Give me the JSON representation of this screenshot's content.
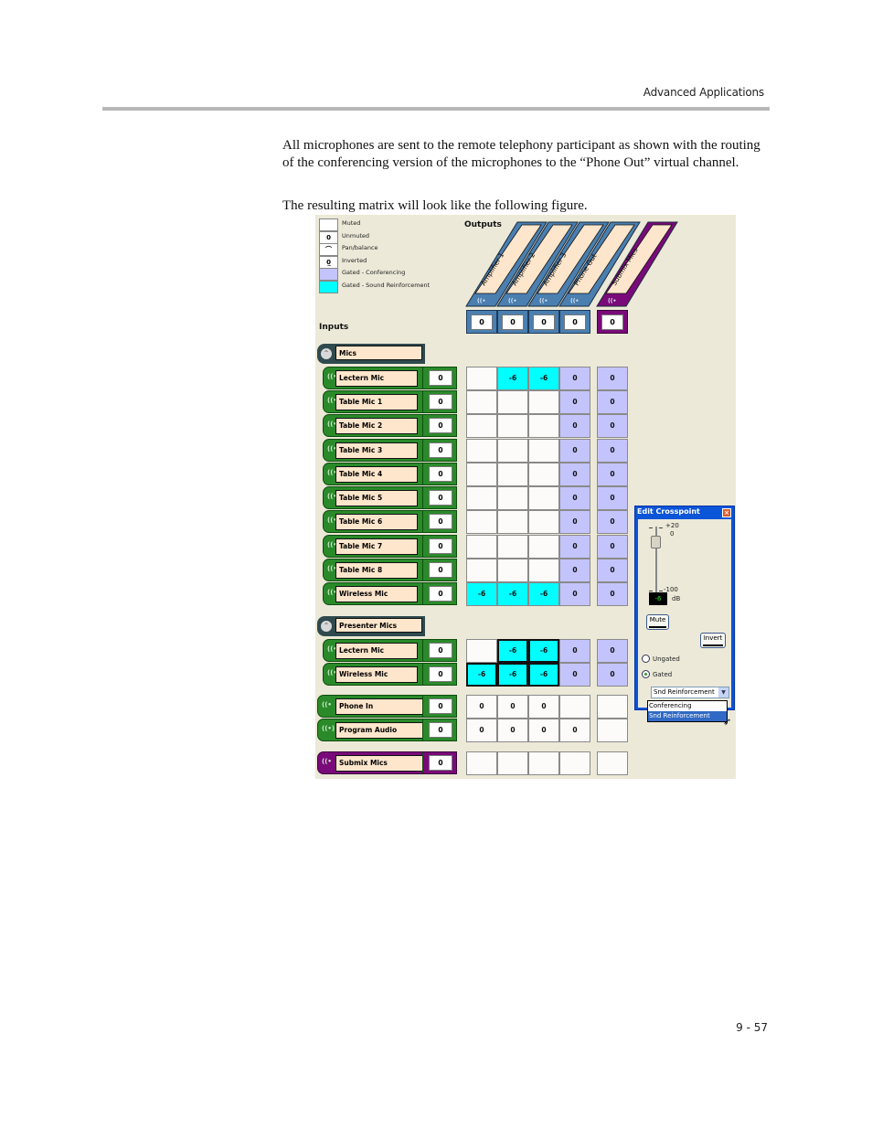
{
  "page": {
    "header_title": "Advanced Applications",
    "paragraphs": [
      "All microphones are sent to the remote telephony participant as shown with the routing of the conferencing version of the microphones to the “Phone Out” virtual channel.",
      "The resulting matrix will look like the following figure."
    ],
    "page_number": "9 - 57"
  },
  "matrix": {
    "legend": [
      {
        "swatch": "",
        "label": "Muted",
        "color": "#ffffff"
      },
      {
        "swatch": "0",
        "label": "Unmuted",
        "color": "#ffffff"
      },
      {
        "swatch": "⌒",
        "label": "Pan/balance",
        "color": "#ffffff"
      },
      {
        "swatch": "0̲",
        "label": "Inverted",
        "color": "#ffffff"
      },
      {
        "swatch": "",
        "label": "Gated - Conferencing",
        "color": "#c4c4fc"
      },
      {
        "swatch": "",
        "label": "Gated - Sound Reinforcement",
        "color": "#00ffff"
      }
    ],
    "outputs_label": "Outputs",
    "inputs_label": "Inputs",
    "outputs": [
      {
        "name": "Amplifier 1",
        "gain": "0",
        "color": "#4a7fb0"
      },
      {
        "name": "Amplifier 2",
        "gain": "0",
        "color": "#4a7fb0"
      },
      {
        "name": "Amplifier 3",
        "gain": "0",
        "color": "#4a7fb0"
      },
      {
        "name": "Phone Out",
        "gain": "0",
        "color": "#4a7fb0"
      },
      {
        "name": "Submix Mics",
        "gain": "0",
        "color": "#7a0a7a"
      }
    ],
    "groups": [
      {
        "name": "Mics"
      },
      {
        "name": "Presenter Mics"
      }
    ],
    "inputs": [
      {
        "name": "Lectern Mic",
        "gain": "0",
        "icon": "((•",
        "cells": [
          [
            "",
            ""
          ],
          [
            "-6",
            "sr"
          ],
          [
            "-6",
            "sr"
          ],
          [
            "0",
            "conf"
          ],
          [
            "0",
            "conf"
          ]
        ]
      },
      {
        "name": "Table Mic 1",
        "gain": "0",
        "icon": "((•",
        "cells": [
          [
            "",
            ""
          ],
          [
            "",
            ""
          ],
          [
            "",
            ""
          ],
          [
            "0",
            "conf"
          ],
          [
            "0",
            "conf"
          ]
        ]
      },
      {
        "name": "Table Mic 2",
        "gain": "0",
        "icon": "((•",
        "cells": [
          [
            "",
            ""
          ],
          [
            "",
            ""
          ],
          [
            "",
            ""
          ],
          [
            "0",
            "conf"
          ],
          [
            "0",
            "conf"
          ]
        ]
      },
      {
        "name": "Table Mic 3",
        "gain": "0",
        "icon": "((•",
        "cells": [
          [
            "",
            ""
          ],
          [
            "",
            ""
          ],
          [
            "",
            ""
          ],
          [
            "0",
            "conf"
          ],
          [
            "0",
            "conf"
          ]
        ]
      },
      {
        "name": "Table Mic 4",
        "gain": "0",
        "icon": "((•",
        "cells": [
          [
            "",
            ""
          ],
          [
            "",
            ""
          ],
          [
            "",
            ""
          ],
          [
            "0",
            "conf"
          ],
          [
            "0",
            "conf"
          ]
        ]
      },
      {
        "name": "Table Mic 5",
        "gain": "0",
        "icon": "((•",
        "cells": [
          [
            "",
            ""
          ],
          [
            "",
            ""
          ],
          [
            "",
            ""
          ],
          [
            "0",
            "conf"
          ],
          [
            "0",
            "conf"
          ]
        ]
      },
      {
        "name": "Table Mic 6",
        "gain": "0",
        "icon": "((•",
        "cells": [
          [
            "",
            ""
          ],
          [
            "",
            ""
          ],
          [
            "",
            ""
          ],
          [
            "0",
            "conf"
          ],
          [
            "0",
            "conf"
          ]
        ]
      },
      {
        "name": "Table Mic 7",
        "gain": "0",
        "icon": "((•",
        "cells": [
          [
            "",
            ""
          ],
          [
            "",
            ""
          ],
          [
            "",
            ""
          ],
          [
            "0",
            "conf"
          ],
          [
            "0",
            "conf"
          ]
        ]
      },
      {
        "name": "Table Mic 8",
        "gain": "0",
        "icon": "((•",
        "cells": [
          [
            "",
            ""
          ],
          [
            "",
            ""
          ],
          [
            "",
            ""
          ],
          [
            "0",
            "conf"
          ],
          [
            "0",
            "conf"
          ]
        ]
      },
      {
        "name": "Wireless Mic",
        "gain": "0",
        "icon": "((•",
        "cells": [
          [
            "-6",
            "sr"
          ],
          [
            "-6",
            "sr"
          ],
          [
            "-6",
            "sr"
          ],
          [
            "0",
            "conf"
          ],
          [
            "0",
            "conf"
          ]
        ]
      },
      {
        "name": "Lectern Mic",
        "gain": "0",
        "icon": "((•",
        "cells": [
          [
            "",
            ""
          ],
          [
            "-6",
            "sr sel"
          ],
          [
            "-6",
            "sr sel"
          ],
          [
            "0",
            "conf"
          ],
          [
            "0",
            "conf"
          ]
        ]
      },
      {
        "name": "Wireless Mic",
        "gain": "0",
        "icon": "((•",
        "cells": [
          [
            "-6",
            "sr sel"
          ],
          [
            "-6",
            "sr sel"
          ],
          [
            "-6",
            "sr sel"
          ],
          [
            "0",
            "conf"
          ],
          [
            "0",
            "conf"
          ]
        ]
      },
      {
        "name": "Phone In",
        "gain": "0",
        "icon": "((•",
        "cells": [
          [
            "0",
            ""
          ],
          [
            "0",
            ""
          ],
          [
            "0",
            ""
          ],
          [
            "",
            ""
          ],
          [
            "",
            ""
          ]
        ]
      },
      {
        "name": "Program Audio",
        "gain": "0",
        "icon": "((•))",
        "cells": [
          [
            "0",
            ""
          ],
          [
            "0",
            ""
          ],
          [
            "0",
            ""
          ],
          [
            "0",
            ""
          ],
          [
            "",
            ""
          ]
        ]
      },
      {
        "name": "Submix Mics",
        "gain": "0",
        "icon": "((•",
        "cells": [
          [
            "",
            ""
          ],
          [
            "",
            ""
          ],
          [
            "",
            ""
          ],
          [
            "",
            ""
          ],
          [
            "",
            ""
          ]
        ]
      }
    ]
  },
  "dialog": {
    "title": "Edit Crosspoint",
    "scale_max": "+20",
    "scale_zero": "0",
    "scale_min": "-100",
    "level_value": "-6",
    "level_unit": "dB",
    "mute_label": "Mute",
    "invert_label": "Invert",
    "ungated_label": "Ungated",
    "gated_label": "Gated",
    "gated_selected": true,
    "gate_mode_selected": "Snd Reinforcement",
    "gate_mode_options": [
      "Conferencing",
      "Snd Reinforcement"
    ]
  }
}
